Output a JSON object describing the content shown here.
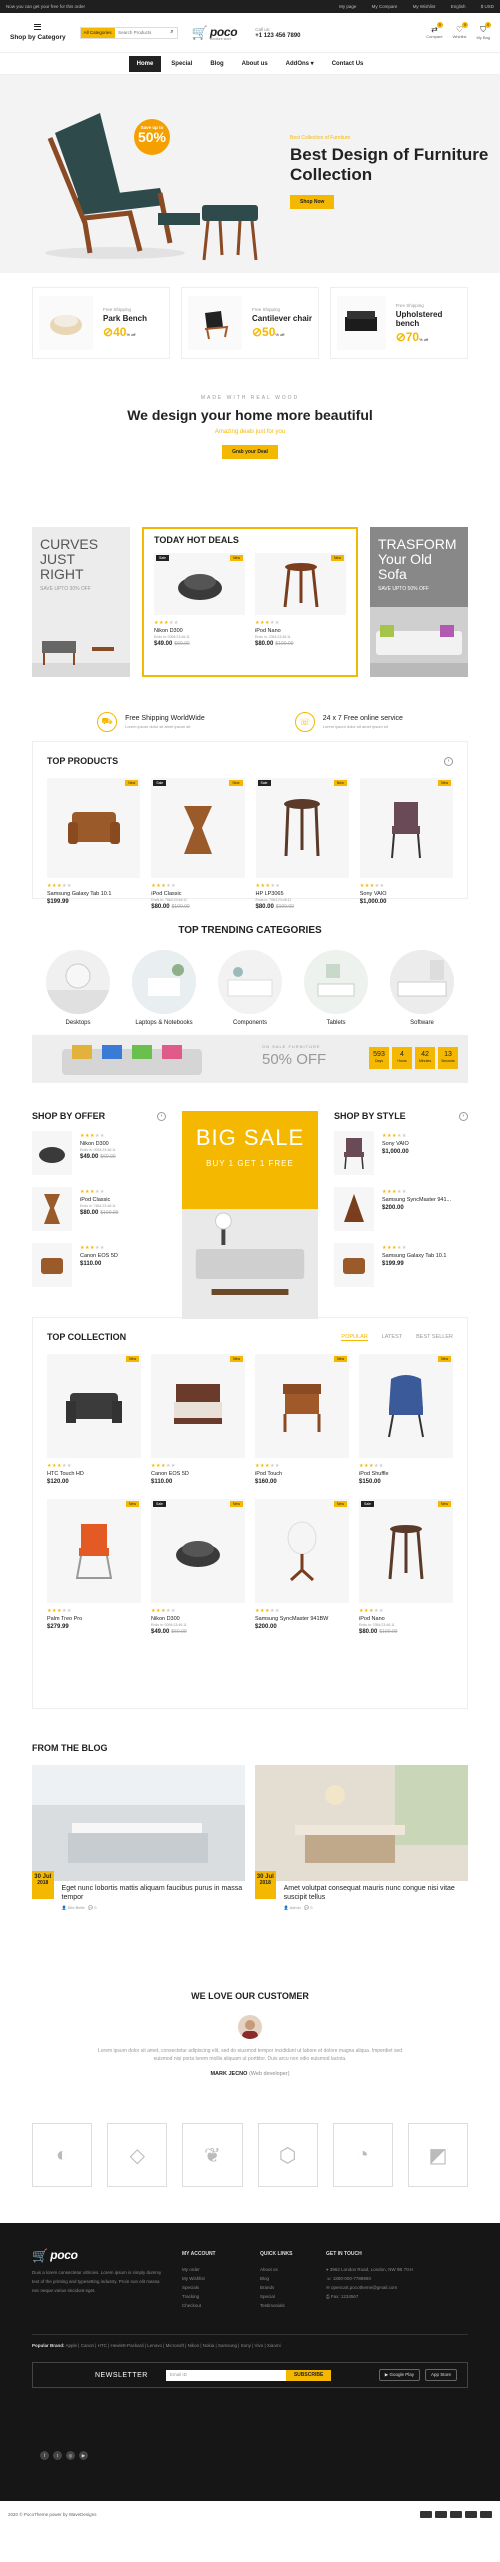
{
  "topbar": {
    "left": "Now you can get your free for this order",
    "links": [
      "My page",
      "My Compare",
      "My Wishlist",
      "English",
      "$ USD"
    ]
  },
  "header": {
    "category_label": "Shop by Category",
    "search_cat": "All Categories",
    "search_placeholder": "Search Products",
    "logo": "poco",
    "logo_sub": "furniture store",
    "call_label": "Call us:",
    "phone": "+1 123 456 7890",
    "icons": [
      {
        "label": "Compare",
        "count": "0"
      },
      {
        "label": "Wishlist",
        "count": "0"
      },
      {
        "label": "My Bag",
        "count": "0"
      }
    ]
  },
  "nav": [
    "Home",
    "Special",
    "Blog",
    "About us",
    "AddOns",
    "Contact Us"
  ],
  "hero": {
    "kicker": "Best Collection of Furniture",
    "title": "Best Design of Furniture Collection",
    "button": "Shop Now",
    "badge_small": "Save up to",
    "badge_big": "50%"
  },
  "promos": [
    {
      "kicker": "Free Shipping",
      "title": "Park Bench",
      "value": "40",
      "unit": "% off"
    },
    {
      "kicker": "Free Shipping",
      "title": "Cantilever chair",
      "value": "50",
      "unit": "% off"
    },
    {
      "kicker": "Free Shipping",
      "title": "Upholstered bench",
      "value": "70",
      "unit": "% off"
    }
  ],
  "design": {
    "kicker": "MADE WITH REAL WOOD",
    "title": "We design your home more beautiful",
    "sub": "Amazing deals just for you",
    "button": "Grab your Deal"
  },
  "left_banner": {
    "t1": "CURVES JUST RIGHT",
    "t2": "SAVE UPTO 30% OFF"
  },
  "right_banner": {
    "t1": "TRASFORM Your Old Sofa",
    "t2": "SAVE UPTO 50% OFF"
  },
  "hotdeals": {
    "title": "TODAY HOT DEALS",
    "items": [
      {
        "name": "Nikon D300",
        "ends": "Ends in: 0094:23:46:11",
        "price": "$49.00",
        "old": "$60.00",
        "sale": "Sale",
        "new": "New"
      },
      {
        "name": "iPod Nano",
        "ends": "Ends in: 2354:23:46:11",
        "price": "$80.00",
        "old": "$100.00",
        "new": "New"
      }
    ]
  },
  "shipping": [
    {
      "title": "Free Shipping WorldWide",
      "sub": "Lorem ipsum dolor sit amet ipsum sit"
    },
    {
      "title": "24 x 7 Free online service",
      "sub": "Lorem ipsum dolor sit amet ipsum sit"
    }
  ],
  "topproducts": {
    "title": "TOP PRODUCTS",
    "items": [
      {
        "name": "Samsung Galaxy Tab 10.1",
        "price": "$199.99",
        "ends": "",
        "old": "",
        "new": "New"
      },
      {
        "name": "iPod Classic",
        "ends": "Ends in: 7664:23:46:11",
        "price": "$80.00",
        "old": "$100.00",
        "sale": "Sale",
        "new": "New"
      },
      {
        "name": "HP LP3065",
        "ends": "Ends in: 7064:23:46:11",
        "price": "$80.00",
        "old": "$100.00",
        "sale": "Sale",
        "new": "New"
      },
      {
        "name": "Sony VAIO",
        "price": "$1,000.00",
        "ends": "",
        "old": "",
        "new": "New"
      }
    ]
  },
  "trending": {
    "title": "TOP TRENDING CATEGORIES",
    "items": [
      "Desktops",
      "Laptops & Notebooks",
      "Components",
      "Tablets",
      "Software"
    ]
  },
  "sofa": {
    "kicker": "ON SALE FURNITURE",
    "big": "50% OFF",
    "countdown": [
      {
        "n": "593",
        "u": "Days"
      },
      {
        "n": "4",
        "u": "Hours"
      },
      {
        "n": "42",
        "u": "Minutes"
      },
      {
        "n": "13",
        "u": "Seconds"
      }
    ]
  },
  "shopbyoffer": {
    "title": "SHOP BY OFFER",
    "items": [
      {
        "name": "Nikon D300",
        "ends": "Ends in: 0094:23:46:11",
        "price": "$49.00",
        "old": "$60.00"
      },
      {
        "name": "iPod Classic",
        "ends": "Ends in: 7664:23:46:11",
        "price": "$80.00",
        "old": "$100.00"
      },
      {
        "name": "Canon EOS 5D",
        "price": "$110.00",
        "ends": "",
        "old": ""
      }
    ]
  },
  "bigsale": {
    "t1": "BIG SALE",
    "t2": "BUY 1 GET 1 FREE"
  },
  "shopbystyle": {
    "title": "SHOP BY STYLE",
    "items": [
      {
        "name": "Sony VAIO",
        "price": "$1,000.00"
      },
      {
        "name": "Samsung SyncMaster 941...",
        "price": "$200.00"
      },
      {
        "name": "Samsung Galaxy Tab 10.1",
        "price": "$199.99"
      }
    ]
  },
  "collection": {
    "title": "TOP COLLECTION",
    "tabs": [
      "POPULAR",
      "LATEST",
      "BEST SELLER"
    ],
    "items": [
      {
        "name": "HTC Touch HD",
        "price": "$120.00",
        "new": "New"
      },
      {
        "name": "Canon EOS 5D",
        "price": "$110.00",
        "new": "New"
      },
      {
        "name": "iPod Touch",
        "price": "$160.00",
        "new": "New"
      },
      {
        "name": "iPod Shuffle",
        "price": "$150.00",
        "new": "New"
      },
      {
        "name": "Palm Treo Pro",
        "price": "$279.99",
        "new": "New"
      },
      {
        "name": "Nikon D300",
        "ends": "Ends in: 0094:23:46:11",
        "price": "$49.00",
        "old": "$60.00",
        "sale": "Sale",
        "new": "New"
      },
      {
        "name": "Samsung SyncMaster 941BW",
        "price": "$200.00",
        "new": "New"
      },
      {
        "name": "iPod Nano",
        "ends": "Ends in: 2354:23:46:11",
        "price": "$80.00",
        "old": "$100.00",
        "sale": "Sale",
        "new": "New"
      }
    ]
  },
  "blog": {
    "title": "FROM THE BLOG",
    "posts": [
      {
        "day": "30 Jul",
        "year": "2018",
        "title": "Eget nunc lobortis mattis aliquam faucibus purus in massa tempor",
        "author": "Site Belfe",
        "comments": "0"
      },
      {
        "day": "30 Jul",
        "year": "2018",
        "title": "Amet volutpat consequat mauris nunc congue nisi vitae suscipit tellus",
        "author": "Admin",
        "comments": "0"
      }
    ]
  },
  "testimonial": {
    "title": "WE LOVE OUR CUSTOMER",
    "quote": "Lorem ipsum dolor sit amet, consectetur adipiscing elit, sed do eiusmod tempor incididunt ut labore et dolore magna aliqua. Imperdiet sed euismod nisi porta lorem mollis aliquam ut porttitor. Duis arcu non odio euismod lacinia.",
    "name": "MARK JECNO",
    "role": "(Web developer)"
  },
  "footer": {
    "about": "Duis a lorem consectetur ultricies. Lorem ipsum is simply dummy text of the printing and typesetting industry. Proin non elit massa nec neque varius tincidunt eget.",
    "account": {
      "title": "MY ACCOUNT",
      "items": [
        "My order",
        "My Wishlist",
        "Specials",
        "Tracking",
        "Checkout"
      ]
    },
    "links": {
      "title": "QUICK LINKS",
      "items": [
        "About us",
        "Blog",
        "Brands",
        "Special",
        "Testimonials"
      ]
    },
    "contact": {
      "title": "GET IN TOUCH",
      "items": [
        "3962 London Road, London, NW 9B 7GH",
        "1800-000-7788990",
        "opencart.pocotheme@gmail.com",
        "Fax: 1234567"
      ]
    },
    "popular_label": "Popular Brand:",
    "popular": "Apple | Canon | HTC | Hewlett-Packard | Lenovo | Microsoft | Nikon | Nokia | Samsung | Sony | Vivo | Xiaomi",
    "newsletter": "NEWSLETTER",
    "email_placeholder": "Email ID",
    "subscribe": "SUBSCRIBE",
    "apps": [
      "Google Play",
      "App Store"
    ],
    "copyright": "2020 © PocoTheme power by WaveDesigns"
  }
}
